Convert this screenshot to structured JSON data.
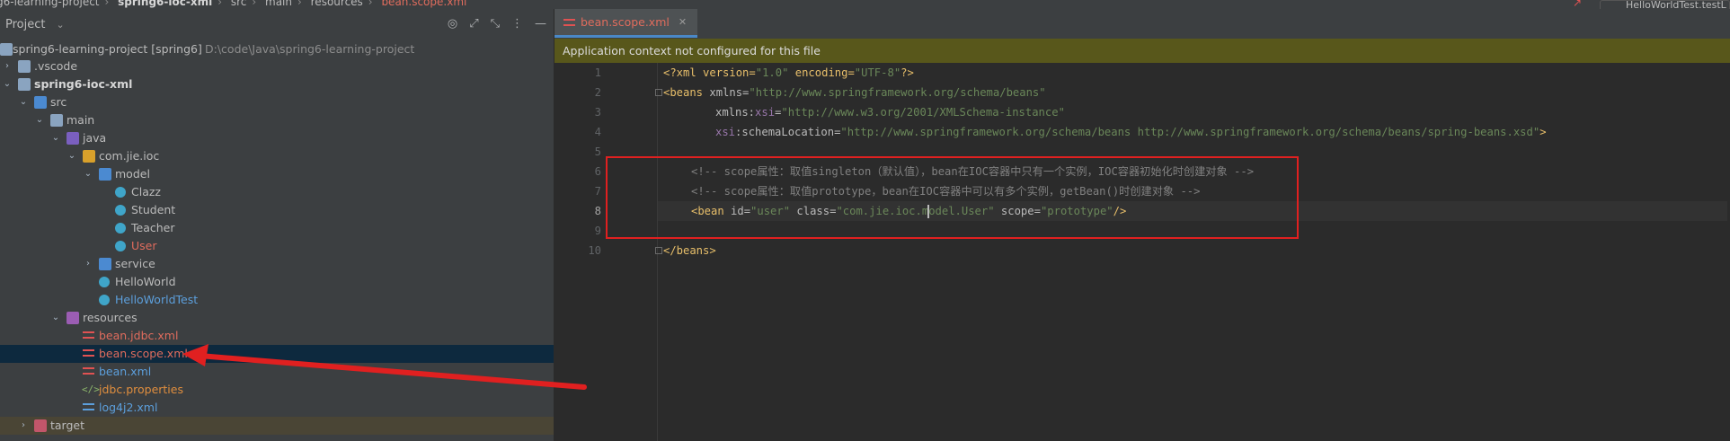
{
  "breadcrumb": {
    "items": [
      "g6-learning-project",
      "spring6-ioc-xml",
      "src",
      "main",
      "resources"
    ],
    "current": "bean.scope.xml"
  },
  "run_config": {
    "label": "HelloWorldTest.testL"
  },
  "project_panel": {
    "title": "Project",
    "tools": [
      "target-icon",
      "expand-icon",
      "collapse-icon",
      "more-icon",
      "hide-icon"
    ]
  },
  "tree": [
    {
      "label": "spring6-learning-project [spring6]",
      "extra": "D:\\code\\Java\\spring6-learning-project",
      "depth": 0,
      "arrow": "",
      "icon": "folder"
    },
    {
      "label": ".vscode",
      "depth": 0,
      "arrow": "›",
      "icon": "folder"
    },
    {
      "label": "spring6-ioc-xml",
      "depth": 0,
      "arrow": "⌄",
      "icon": "folder"
    },
    {
      "label": "src",
      "depth": 1,
      "arrow": "⌄",
      "icon": "src"
    },
    {
      "label": "main",
      "depth": 2,
      "arrow": "⌄",
      "icon": "folder"
    },
    {
      "label": "java",
      "depth": 3,
      "arrow": "⌄",
      "icon": "javasrc"
    },
    {
      "label": "com.jie.ioc",
      "depth": 4,
      "arrow": "⌄",
      "icon": "pkg"
    },
    {
      "label": "model",
      "depth": 5,
      "arrow": "⌄",
      "icon": "src"
    },
    {
      "label": "Clazz",
      "depth": 6,
      "arrow": "",
      "icon": "class"
    },
    {
      "label": "Student",
      "depth": 6,
      "arrow": "",
      "icon": "class"
    },
    {
      "label": "Teacher",
      "depth": 6,
      "arrow": "",
      "icon": "class"
    },
    {
      "label": "User",
      "depth": 6,
      "arrow": "",
      "icon": "class"
    },
    {
      "label": "service",
      "depth": 5,
      "arrow": "›",
      "icon": "src"
    },
    {
      "label": "HelloWorld",
      "depth": 5,
      "arrow": "",
      "icon": "class"
    },
    {
      "label": "HelloWorldTest",
      "depth": 5,
      "arrow": "",
      "icon": "class"
    },
    {
      "label": "resources",
      "depth": 3,
      "arrow": "⌄",
      "icon": "res"
    },
    {
      "label": "bean.jdbc.xml",
      "depth": 4,
      "arrow": "",
      "icon": "xml"
    },
    {
      "label": "bean.scope.xml",
      "depth": 4,
      "arrow": "",
      "icon": "xml"
    },
    {
      "label": "bean.xml",
      "depth": 4,
      "arrow": "",
      "icon": "xml"
    },
    {
      "label": "jdbc.properties",
      "depth": 4,
      "arrow": "",
      "icon": "prop"
    },
    {
      "label": "log4j2.xml",
      "depth": 4,
      "arrow": "",
      "icon": "xml"
    },
    {
      "label": "target",
      "depth": 1,
      "arrow": "›",
      "icon": "target"
    }
  ],
  "editor": {
    "tab_label": "bean.scope.xml",
    "banner": "Application context not configured for this file",
    "line_numbers": [
      "1",
      "2",
      "3",
      "4",
      "5",
      "6",
      "7",
      "8",
      "9",
      "10"
    ],
    "lines": {
      "l1": [
        "<?xml version=",
        "\"1.0\"",
        " encoding=",
        "\"UTF-8\"",
        "?>"
      ],
      "l2": [
        "<beans ",
        "xmlns=",
        "\"http://www.springframework.org/schema/beans\""
      ],
      "l3": [
        "xmlns:",
        "xsi",
        "=",
        "\"http://www.w3.org/2001/XMLSchema-instance\""
      ],
      "l4": [
        "xsi",
        ":schemaLocation=",
        "\"http://www.springframework.org/schema/beans http://www.springframework.org/schema/beans/spring-beans.xsd\"",
        ">"
      ],
      "l6": "<!-- scope属性：取值singleton（默认值），bean在IOC容器中只有一个实例，IOC容器初始化时创建对象 -->",
      "l7": "<!-- scope属性：取值prototype，bean在IOC容器中可以有多个实例，getBean()时创建对象 -->",
      "l8": [
        "<bean ",
        "id=",
        "\"user\"",
        " class=",
        "\"com.jie.ioc.m",
        "odel.User\"",
        " scope=",
        "\"prototype\"",
        "/>"
      ],
      "l10": "</beans>"
    }
  },
  "colors": {
    "annotation": "#e02020",
    "banner": "#58571b",
    "selection": "#0d293e"
  }
}
